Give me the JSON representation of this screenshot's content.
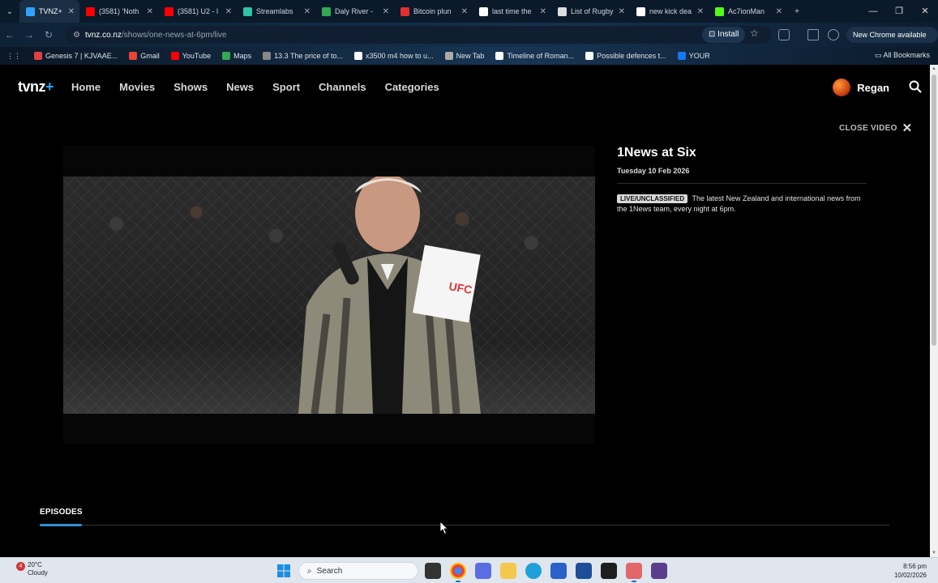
{
  "browser": {
    "tabs": [
      {
        "label": "TVNZ+",
        "active": true,
        "color": "#2da3ff"
      },
      {
        "label": "(3581) 'Noth",
        "color": "#ff0000"
      },
      {
        "label": "(3581) U2 - l",
        "color": "#ff0000"
      },
      {
        "label": "Streamlabs",
        "color": "#31c3a2"
      },
      {
        "label": "Daly River -",
        "color": "#34a853"
      },
      {
        "label": "Bitcoin plun",
        "color": "#e03030"
      },
      {
        "label": "last time the",
        "color": "#ffffff"
      },
      {
        "label": "List of Rugby",
        "color": "#dddddd"
      },
      {
        "label": "new kick dea",
        "color": "#ffffff"
      },
      {
        "label": "Ac7ionMan",
        "color": "#53fc18"
      }
    ],
    "new_tab_symbol": "+",
    "url_host": "tvnz.co.nz",
    "url_path": "/shows/one-news-at-6pm/live",
    "install_label": "Install",
    "update_label": "New Chrome available",
    "bookmarks": [
      {
        "label": "Genesis 7 | KJVAAE...",
        "color": "#e04040"
      },
      {
        "label": "Gmail",
        "color": "#ea4335"
      },
      {
        "label": "YouTube",
        "color": "#ff0000"
      },
      {
        "label": "Maps",
        "color": "#34a853"
      },
      {
        "label": "13.3 The price of to...",
        "color": "#888888"
      },
      {
        "label": "x3500 m4 how to u...",
        "color": "#ffffff"
      },
      {
        "label": "New Tab",
        "color": "#aaaaaa"
      },
      {
        "label": "Timeline of Roman...",
        "color": "#ffffff"
      },
      {
        "label": "Possible defences t...",
        "color": "#ffffff"
      },
      {
        "label": "YOUR",
        "color": "#1877f2"
      }
    ],
    "all_bookmarks_label": "All Bookmarks"
  },
  "site": {
    "logo": "tvnz",
    "logo_plus": "+",
    "nav": [
      "Home",
      "Movies",
      "Shows",
      "News",
      "Sport",
      "Channels",
      "Categories"
    ],
    "user_name": "Regan",
    "close_video_label": "CLOSE VIDEO"
  },
  "show": {
    "title": "1News at Six",
    "date": "Tuesday 10 Feb 2026",
    "rating_badge": "LIVE/UNCLASSIFIED",
    "description": "The latest New Zealand and international news from the 1News team, every night at 6pm."
  },
  "episodes_label": "EPISODES",
  "taskbar": {
    "weather_badge": "4",
    "temperature": "20°C",
    "condition": "Cloudy",
    "search_placeholder": "Search",
    "time": "8:56 pm",
    "date": "10/02/2026"
  },
  "colors": {
    "accent": "#2f8ed6",
    "background": "#000000"
  }
}
